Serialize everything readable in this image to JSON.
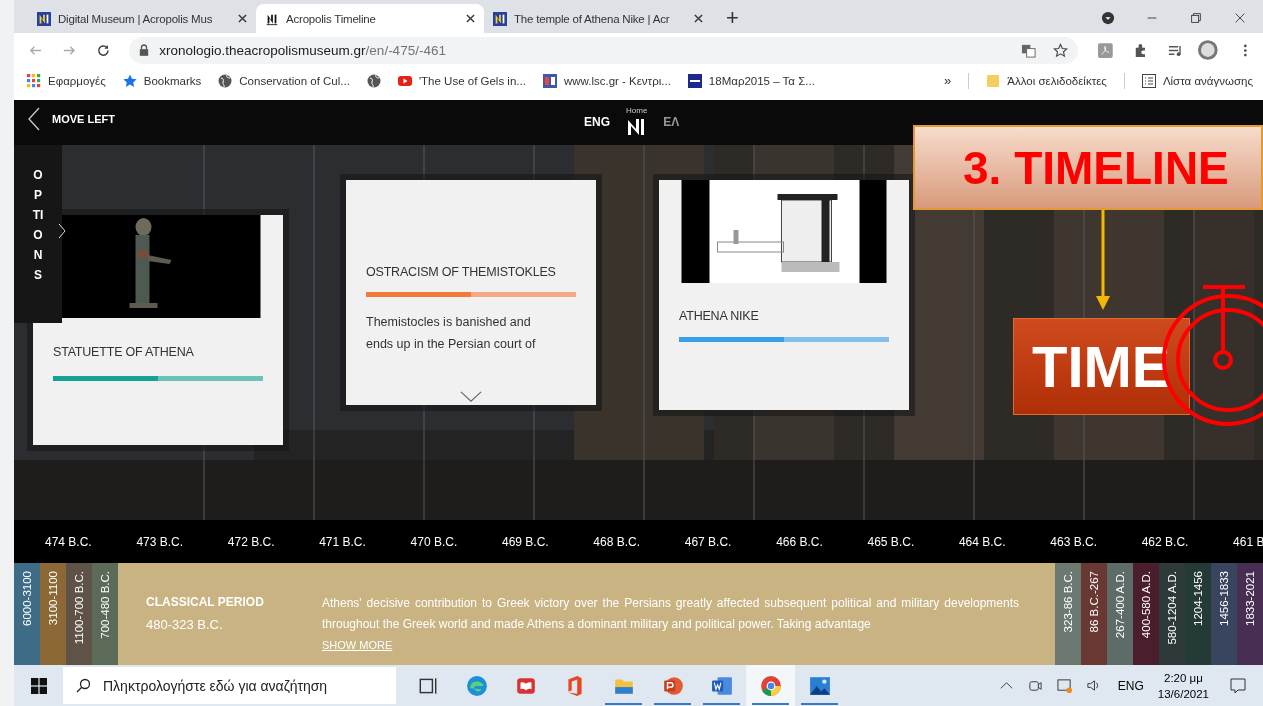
{
  "browser": {
    "tabs": [
      {
        "title": "Digital Museum | Acropolis Mus",
        "selected": false,
        "kind": "museum"
      },
      {
        "title": "Acropolis Timeline",
        "selected": true,
        "kind": "timeline"
      },
      {
        "title": "The temple of Athena Nike | Acr",
        "selected": false,
        "kind": "museum"
      }
    ],
    "new_tab": "+",
    "address": {
      "host": "xronologio.theacropolismuseum.gr",
      "path": "/en/-475/-461"
    },
    "bookmarks": [
      {
        "kind": "apps",
        "label": "Εφαρμογές"
      },
      {
        "kind": "star",
        "label": "Bookmarks"
      },
      {
        "kind": "globe",
        "label": "Conservation of Cul..."
      },
      {
        "kind": "globe"
      },
      {
        "kind": "youtube",
        "label": "'The Use of Gels in..."
      },
      {
        "kind": "site",
        "label": "www.lsc.gr - Κεντρι..."
      },
      {
        "kind": "ert",
        "label": "18Μαρ2015 – Τα Σ..."
      }
    ],
    "more": "»",
    "other_bookmarks": "Άλλοι σελιδοδείκτες",
    "reading_list": "Λίστα ανάγνωσης"
  },
  "nav": {
    "move_left": "MOVE LEFT",
    "home": "Home",
    "languages": [
      {
        "label": "ENG",
        "selected": true
      },
      {
        "label": "ΕΛ",
        "selected": false
      }
    ]
  },
  "options": "OPTIONS",
  "cards": [
    {
      "title": "STATUETTE OF ATHENA",
      "color": "#13a394",
      "level": 0.5
    },
    {
      "kind": "text",
      "title": "OSTRACISM OF THEMISTOKLES",
      "color": "#f47a3c",
      "level": 0.5,
      "text": "Themistocles is banished and ends up in the Persian court of"
    },
    {
      "title": "ATHENA NIKE",
      "color": "#3aa0e6",
      "level": 0.5
    }
  ],
  "years": [
    "474 B.C.",
    "473 B.C.",
    "472 B.C.",
    "471 B.C.",
    "470 B.C.",
    "469 B.C.",
    "468 B.C.",
    "467 B.C.",
    "466 B.C.",
    "465 B.C.",
    "464 B.C.",
    "463 B.C.",
    "462 B.C.",
    "461 B"
  ],
  "periods_before": [
    {
      "label": "6000-3100",
      "color": "#3e6c87"
    },
    {
      "label": "3100-1100",
      "color": "#8c6836"
    },
    {
      "label": "1100-700 B.C.",
      "color": "#5f5247"
    },
    {
      "label": "700-480 B.C.",
      "color": "#5b6b57"
    }
  ],
  "period": {
    "title": "CLASSICAL PERIOD",
    "dates": "480-323 B.C.",
    "text": "Athens' decisive contribution to Greek victory over the Persians greatly affected subsequent political and military developments throughout the Greek world and made Athens a dominant military and political power. Taking advantage",
    "show_more": "SHOW MORE"
  },
  "periods_after": [
    {
      "label": "323-86 B.C.",
      "color": "#6b7970"
    },
    {
      "label": "86 B.C.-267",
      "color": "#6a3832"
    },
    {
      "label": "267-400 A.D.",
      "color": "#5e6c69"
    },
    {
      "label": "400-580 A.D.",
      "color": "#4a1e2d"
    },
    {
      "label": "580-1204 A.D.",
      "color": "#2e3939"
    },
    {
      "label": "1204-1456",
      "color": "#243a37"
    },
    {
      "label": "1456-1833",
      "color": "#39445e"
    },
    {
      "label": "1833-2021",
      "color": "#492e54"
    }
  ],
  "annotation": {
    "heading": "3. TIMELINE",
    "badge": "TIME"
  },
  "taskbar": {
    "search": {
      "placeholder": "Πληκτρολογήστε εδώ για αναζήτηση"
    },
    "apps": [
      {
        "kind": "taskview",
        "running": false,
        "selected": false
      },
      {
        "kind": "edge",
        "running": false,
        "selected": false
      },
      {
        "kind": "mail",
        "running": false,
        "selected": false
      },
      {
        "kind": "office",
        "running": false,
        "selected": false
      },
      {
        "kind": "explorer",
        "running": true,
        "selected": false
      },
      {
        "kind": "powerpoint",
        "running": true,
        "selected": false
      },
      {
        "kind": "word",
        "running": true,
        "selected": false
      },
      {
        "kind": "chrome",
        "running": true,
        "selected": true
      },
      {
        "kind": "photos",
        "running": true,
        "selected": false
      }
    ],
    "language": "ENG",
    "time": "2:20 μμ",
    "date": "13/6/2021"
  }
}
